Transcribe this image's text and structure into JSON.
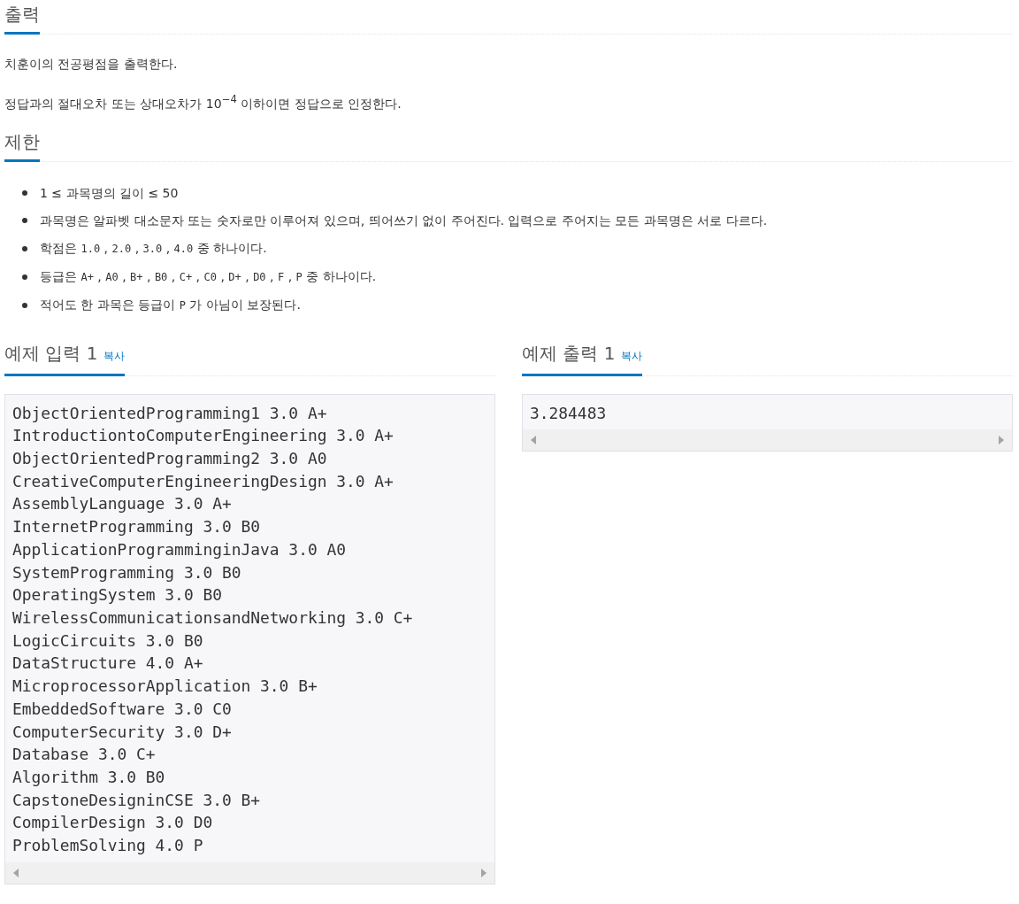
{
  "output_section": {
    "heading": "출력",
    "paragraphs": [
      "치훈이의 전공평점을 출력한다.",
      "정답과의 절대오차 또는 상대오차가 10$^{−4}$ 이하이면 정답으로 인정한다."
    ]
  },
  "limits_section": {
    "heading": "제한",
    "items": [
      [
        {
          "kind": "text",
          "text": "1 ≤ 과목명의 길이 ≤ 50"
        }
      ],
      [
        {
          "kind": "text",
          "text": "과목명은 알파벳 대소문자 또는 숫자로만 이루어져 있으며, 띄어쓰기 없이 주어진다. 입력으로 주어지는 모든 과목명은 서로 다르다."
        }
      ],
      [
        {
          "kind": "text",
          "text": "학점은 "
        },
        {
          "kind": "code",
          "text": "1.0"
        },
        {
          "kind": "text",
          "text": " , "
        },
        {
          "kind": "code",
          "text": "2.0"
        },
        {
          "kind": "text",
          "text": " , "
        },
        {
          "kind": "code",
          "text": "3.0"
        },
        {
          "kind": "text",
          "text": " , "
        },
        {
          "kind": "code",
          "text": "4.0"
        },
        {
          "kind": "text",
          "text": " 중 하나이다."
        }
      ],
      [
        {
          "kind": "text",
          "text": "등급은 "
        },
        {
          "kind": "code",
          "text": "A+"
        },
        {
          "kind": "text",
          "text": " , "
        },
        {
          "kind": "code",
          "text": "A0"
        },
        {
          "kind": "text",
          "text": " , "
        },
        {
          "kind": "code",
          "text": "B+"
        },
        {
          "kind": "text",
          "text": " , "
        },
        {
          "kind": "code",
          "text": "B0"
        },
        {
          "kind": "text",
          "text": " , "
        },
        {
          "kind": "code",
          "text": "C+"
        },
        {
          "kind": "text",
          "text": " , "
        },
        {
          "kind": "code",
          "text": "C0"
        },
        {
          "kind": "text",
          "text": " , "
        },
        {
          "kind": "code",
          "text": "D+"
        },
        {
          "kind": "text",
          "text": " , "
        },
        {
          "kind": "code",
          "text": "D0"
        },
        {
          "kind": "text",
          "text": " , "
        },
        {
          "kind": "code",
          "text": "F"
        },
        {
          "kind": "text",
          "text": " , "
        },
        {
          "kind": "code",
          "text": "P"
        },
        {
          "kind": "text",
          "text": " 중 하나이다."
        }
      ],
      [
        {
          "kind": "text",
          "text": "적어도 한 과목은 등급이 "
        },
        {
          "kind": "code",
          "text": "P"
        },
        {
          "kind": "text",
          "text": " 가 아님이 보장된다."
        }
      ]
    ]
  },
  "samples": [
    {
      "heading": "예제 입력 1",
      "copy_link": "복사",
      "lines": [
        "ObjectOrientedProgramming1 3.0 A+",
        "IntroductiontoComputerEngineering 3.0 A+",
        "ObjectOrientedProgramming2 3.0 A0",
        "CreativeComputerEngineeringDesign 3.0 A+",
        "AssemblyLanguage 3.0 A+",
        "InternetProgramming 3.0 B0",
        "ApplicationProgramminginJava 3.0 A0",
        "SystemProgramming 3.0 B0",
        "OperatingSystem 3.0 B0",
        "WirelessCommunicationsandNetworking 3.0 C+",
        "LogicCircuits 3.0 B0",
        "DataStructure 4.0 A+",
        "MicroprocessorApplication 3.0 B+",
        "EmbeddedSoftware 3.0 C0",
        "ComputerSecurity 3.0 D+",
        "Database 3.0 C+",
        "Algorithm 3.0 B0",
        "CapstoneDesigninCSE 3.0 B+",
        "CompilerDesign 3.0 D0",
        "ProblemSolving 4.0 P"
      ]
    },
    {
      "heading": "예제 출력 1",
      "copy_link": "복사",
      "lines": [
        "3.284483"
      ]
    }
  ]
}
